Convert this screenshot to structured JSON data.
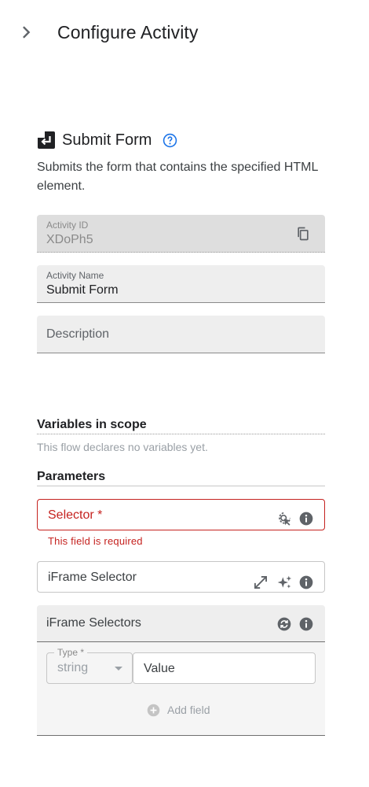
{
  "header": {
    "title": "Configure Activity",
    "collapse_icon": "chevron-right-icon"
  },
  "activity": {
    "icon": "submit-form-icon",
    "title": "Submit Form",
    "help_icon": "help-circle-icon",
    "description": "Submits the form that contains the specified HTML element."
  },
  "fields": {
    "activity_id": {
      "label": "Activity ID",
      "value": "XDoPh5",
      "icon": "copy-icon"
    },
    "activity_name": {
      "label": "Activity Name",
      "value": "Submit Form"
    },
    "description": {
      "placeholder": "Description"
    }
  },
  "variables": {
    "title": "Variables in scope",
    "hint": "This flow declares no variables yet."
  },
  "parameters": {
    "title": "Parameters",
    "selector": {
      "label": "Selector *",
      "error": "This field is required",
      "icons": [
        "element-picker-icon",
        "info-icon"
      ]
    },
    "iframe_selector": {
      "label": "iFrame Selector",
      "icons": [
        "expand-icon",
        "sparkle-icon",
        "info-icon"
      ]
    },
    "iframe_selectors": {
      "title": "iFrame Selectors",
      "icons": [
        "refresh-icon",
        "info-icon"
      ],
      "type_label": "Type *",
      "type_value": "string",
      "value_placeholder": "Value",
      "add_field": "Add field"
    }
  },
  "colors": {
    "error": "#c5221f",
    "accent": "#1a73e8",
    "field_bg": "#eeeeee",
    "icon": "#5f6368"
  }
}
